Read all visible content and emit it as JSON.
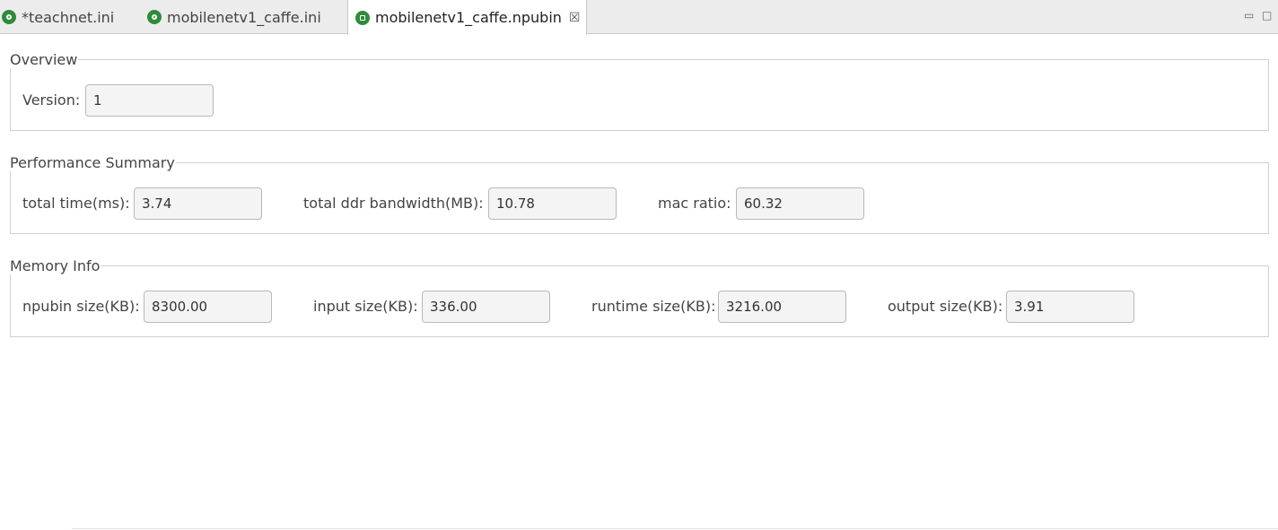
{
  "tabs": [
    {
      "label": "*teachnet.ini",
      "icon": "gear-icon"
    },
    {
      "label": "mobilenetv1_caffe.ini",
      "icon": "gear-icon"
    },
    {
      "label": "mobilenetv1_caffe.npubin",
      "icon": "binary-file-icon",
      "active": true,
      "close": "☒"
    }
  ],
  "window_controls": {
    "minimize": "▭",
    "maximize": "□"
  },
  "overview": {
    "title": "Overview",
    "version_label": "Version:",
    "version_value": "1"
  },
  "performance": {
    "title": "Performance Summary",
    "total_time_label": "total time(ms):",
    "total_time_value": "3.74",
    "ddr_bandwidth_label": "total ddr bandwidth(MB):",
    "ddr_bandwidth_value": "10.78",
    "mac_ratio_label": "mac ratio:",
    "mac_ratio_value": "60.32"
  },
  "memory": {
    "title": "Memory Info",
    "npubin_size_label": "npubin size(KB):",
    "npubin_size_value": "8300.00",
    "input_size_label": "input size(KB):",
    "input_size_value": "336.00",
    "runtime_size_label": "runtime size(KB):",
    "runtime_size_value": "3216.00",
    "output_size_label": "output size(KB):",
    "output_size_value": "3.91"
  },
  "colors": {
    "accent_green": "#2e8b3a",
    "tab_bar": "#ececec"
  }
}
